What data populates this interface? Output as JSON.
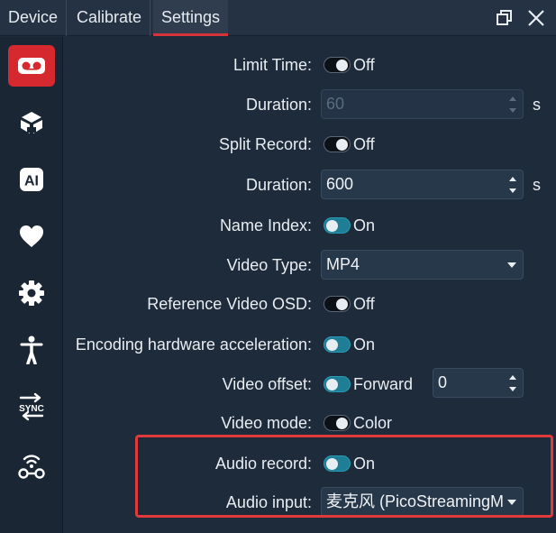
{
  "tabs": [
    {
      "label": "Device"
    },
    {
      "label": "Calibrate"
    },
    {
      "label": "Settings"
    }
  ],
  "window": {
    "restore_icon": "restore-window-icon",
    "close_icon": "close-icon"
  },
  "sidebar": {
    "items": [
      {
        "icon": "record-icon",
        "active": true
      },
      {
        "icon": "tracker-icon"
      },
      {
        "icon": "ai-icon",
        "text": "AI"
      },
      {
        "icon": "heart-icon"
      },
      {
        "icon": "gear-icon"
      },
      {
        "icon": "body-icon"
      },
      {
        "icon": "sync-icon",
        "text": "SYNC"
      },
      {
        "icon": "wireless-device-icon"
      }
    ]
  },
  "settings": {
    "limit_time": {
      "label": "Limit Time:",
      "state": "Off"
    },
    "duration_1": {
      "label": "Duration:",
      "value": "60",
      "unit": "s"
    },
    "split_record": {
      "label": "Split Record:",
      "state": "Off"
    },
    "duration_2": {
      "label": "Duration:",
      "value": "600",
      "unit": "s"
    },
    "name_index": {
      "label": "Name Index:",
      "state": "On"
    },
    "video_type": {
      "label": "Video Type:",
      "value": "MP4"
    },
    "reference_osd": {
      "label": "Reference Video OSD:",
      "state": "Off"
    },
    "hw_accel": {
      "label": "Encoding hardware acceleration:",
      "state": "On"
    },
    "video_offset": {
      "label": "Video offset:",
      "state": "Forward",
      "value": "0"
    },
    "video_mode": {
      "label": "Video mode:",
      "state": "Color"
    },
    "audio_record": {
      "label": "Audio record:",
      "state": "On"
    },
    "audio_input": {
      "label": "Audio input:",
      "value": "麦克风 (PicoStreamingM"
    }
  },
  "colors": {
    "accent_red": "#d5282f",
    "toggle_on": "#1d7e96",
    "highlight": "#e03a3a"
  }
}
